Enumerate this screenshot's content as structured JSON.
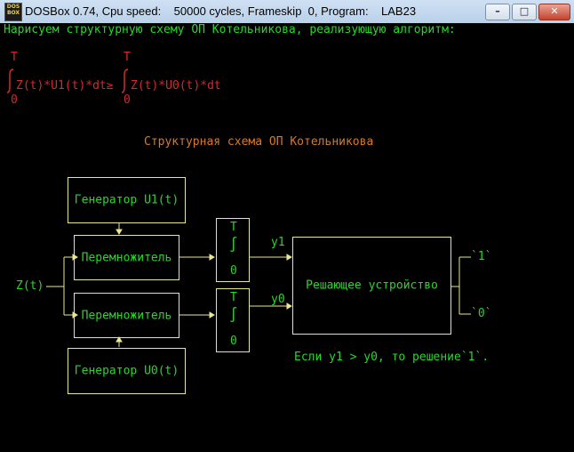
{
  "window": {
    "icon_text": [
      "DOS",
      "BOX"
    ],
    "title": "DOSBox 0.74, Cpu speed:    50000 cycles, Frameskip  0, Program:    LAB23",
    "buttons": {
      "minimize": "–",
      "maximize": "□",
      "close": "✕"
    }
  },
  "screen": {
    "heading": "Нарисуем структурную схему ОП Котельникова, реализующую алгоритм:",
    "formula": {
      "upper_limit": "T",
      "lower_limit": "0",
      "integral1": "Z(t)*U1(t)*dt≥",
      "integral2": "Z(t)*U0(t)*dt"
    },
    "diagram_title": "Структурная схема ОП Котельникова",
    "blocks": {
      "gen_u1": "Генератор U1(t)",
      "mult_top": "Перемножитель",
      "mult_bottom": "Перемножитель",
      "gen_u0": "Генератор U0(t)",
      "integ_upper": "T",
      "integ_lower": "0",
      "integ_sign": "∫",
      "decision": "Решающее устройство"
    },
    "signals": {
      "input": "Z(t)",
      "y1": "y1",
      "y0": "y0",
      "out1": "`1`",
      "out0": "`0`"
    },
    "rule": "Если y1 > y0, то решение`1`."
  }
}
